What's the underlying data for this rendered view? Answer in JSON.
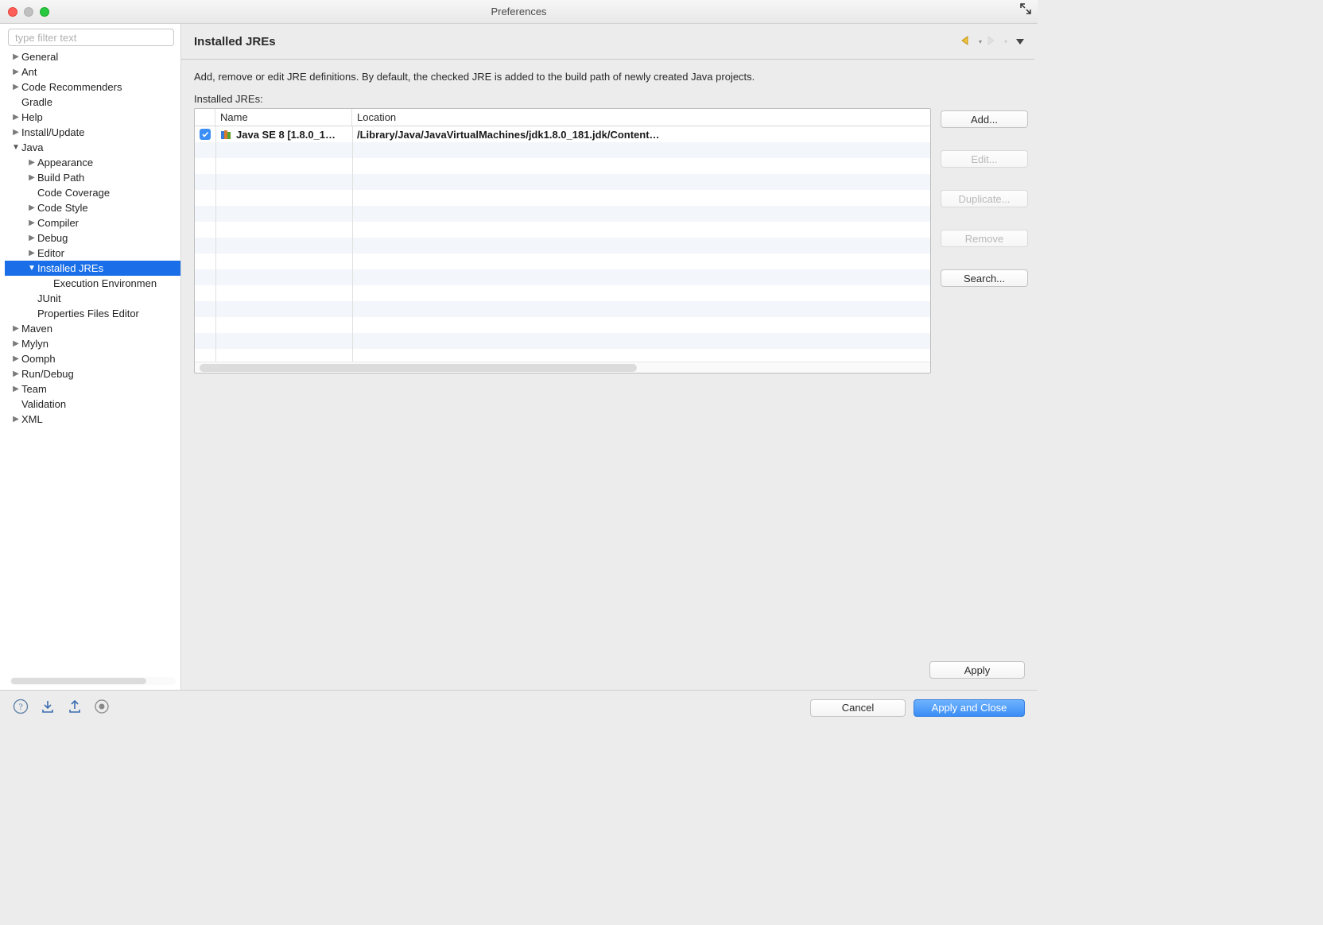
{
  "window": {
    "title": "Preferences"
  },
  "sidebar": {
    "filter_placeholder": "type filter text",
    "items": [
      {
        "label": "General",
        "depth": 0,
        "arrow": "right"
      },
      {
        "label": "Ant",
        "depth": 0,
        "arrow": "right"
      },
      {
        "label": "Code Recommenders",
        "depth": 0,
        "arrow": "right"
      },
      {
        "label": "Gradle",
        "depth": 0,
        "arrow": "none"
      },
      {
        "label": "Help",
        "depth": 0,
        "arrow": "right"
      },
      {
        "label": "Install/Update",
        "depth": 0,
        "arrow": "right"
      },
      {
        "label": "Java",
        "depth": 0,
        "arrow": "down"
      },
      {
        "label": "Appearance",
        "depth": 1,
        "arrow": "right"
      },
      {
        "label": "Build Path",
        "depth": 1,
        "arrow": "right"
      },
      {
        "label": "Code Coverage",
        "depth": 1,
        "arrow": "none"
      },
      {
        "label": "Code Style",
        "depth": 1,
        "arrow": "right"
      },
      {
        "label": "Compiler",
        "depth": 1,
        "arrow": "right"
      },
      {
        "label": "Debug",
        "depth": 1,
        "arrow": "right"
      },
      {
        "label": "Editor",
        "depth": 1,
        "arrow": "right"
      },
      {
        "label": "Installed JREs",
        "depth": 1,
        "arrow": "down",
        "selected": true
      },
      {
        "label": "Execution Environmen",
        "depth": 2,
        "arrow": "none"
      },
      {
        "label": "JUnit",
        "depth": 1,
        "arrow": "none"
      },
      {
        "label": "Properties Files Editor",
        "depth": 1,
        "arrow": "none"
      },
      {
        "label": "Maven",
        "depth": 0,
        "arrow": "right"
      },
      {
        "label": "Mylyn",
        "depth": 0,
        "arrow": "right"
      },
      {
        "label": "Oomph",
        "depth": 0,
        "arrow": "right"
      },
      {
        "label": "Run/Debug",
        "depth": 0,
        "arrow": "right"
      },
      {
        "label": "Team",
        "depth": 0,
        "arrow": "right"
      },
      {
        "label": "Validation",
        "depth": 0,
        "arrow": "none"
      },
      {
        "label": "XML",
        "depth": 0,
        "arrow": "right"
      }
    ]
  },
  "main": {
    "title": "Installed JREs",
    "description": "Add, remove or edit JRE definitions. By default, the checked JRE is added to the build path of newly created Java projects.",
    "table_label": "Installed JREs:",
    "columns": {
      "name": "Name",
      "location": "Location"
    },
    "rows": [
      {
        "checked": true,
        "name": "Java SE 8 [1.8.0_1…",
        "location": "/Library/Java/JavaVirtualMachines/jdk1.8.0_181.jdk/Content…"
      }
    ],
    "buttons": {
      "add": "Add...",
      "edit": "Edit...",
      "duplicate": "Duplicate...",
      "remove": "Remove",
      "search": "Search...",
      "apply": "Apply"
    }
  },
  "footer": {
    "cancel": "Cancel",
    "apply_close": "Apply and Close"
  }
}
